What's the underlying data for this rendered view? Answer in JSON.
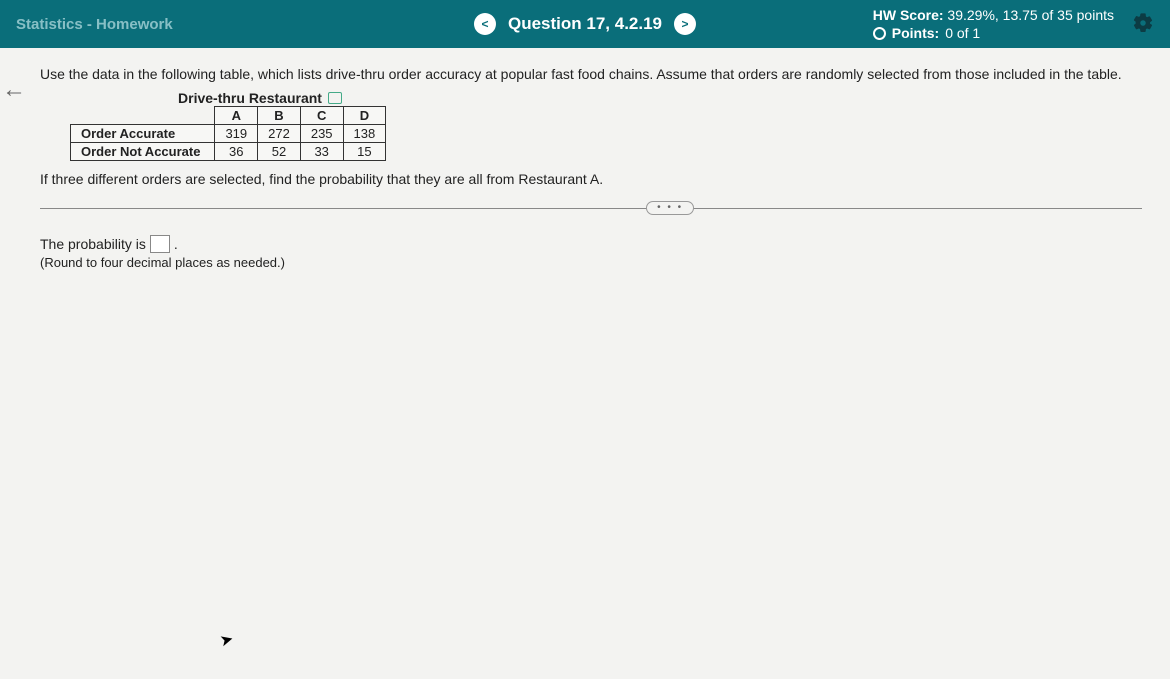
{
  "header": {
    "breadcrumb": "Statistics - Homework",
    "prev_symbol": "<",
    "next_symbol": ">",
    "question_label": "Question 17, 4.2.19",
    "score_label": "HW Score:",
    "score_value": "39.29%, 13.75 of 35 points",
    "points_label": "Points:",
    "points_value": "0 of 1"
  },
  "problem": {
    "intro": "Use the data in the following table, which lists drive-thru order accuracy at popular fast food chains. Assume that orders are randomly selected from those included in the table.",
    "table_caption": "Drive-thru Restaurant",
    "columns": [
      "A",
      "B",
      "C",
      "D"
    ],
    "rows": [
      {
        "label": "Order Accurate",
        "values": [
          "319",
          "272",
          "235",
          "138"
        ]
      },
      {
        "label": "Order Not Accurate",
        "values": [
          "36",
          "52",
          "33",
          "15"
        ]
      }
    ],
    "prompt": "If three different orders are selected, find the probability that they are all from Restaurant A."
  },
  "answer": {
    "prefix": "The probability is",
    "suffix": ".",
    "hint": "(Round to four decimal places as needed.)",
    "value": ""
  },
  "misc": {
    "ellipsis": "• • •"
  }
}
